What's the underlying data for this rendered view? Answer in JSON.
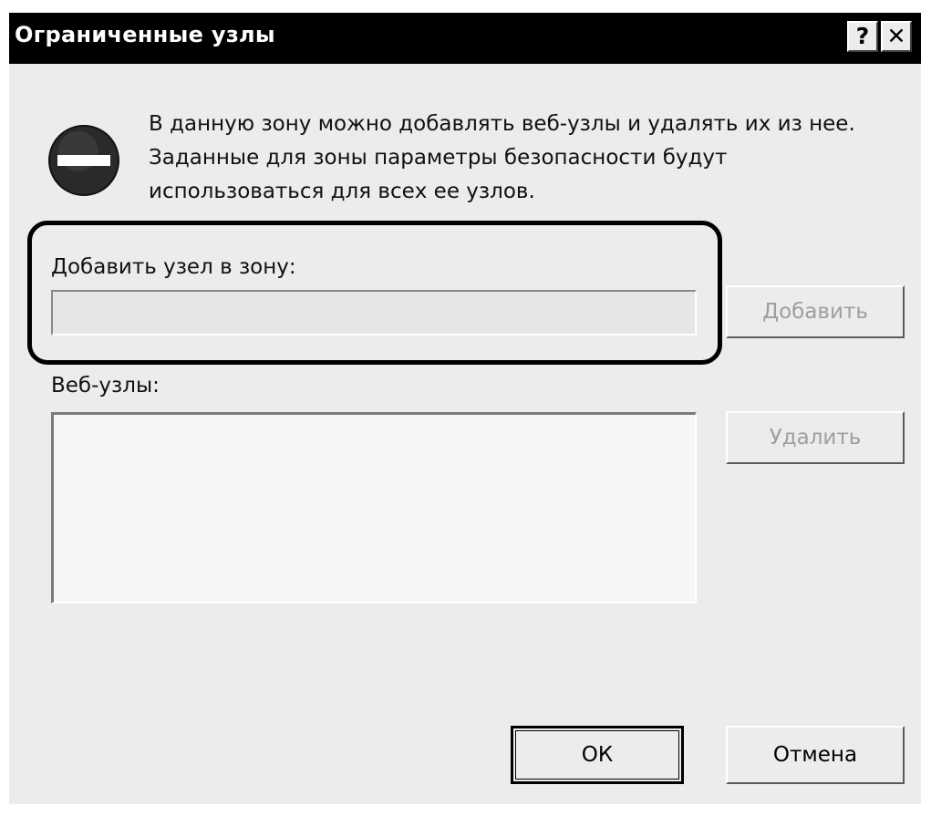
{
  "window": {
    "title": "Ограниченные узлы",
    "help_glyph": "?",
    "close_glyph": "✕"
  },
  "intro": {
    "icon": "restricted-zone-icon",
    "text": "В данную зону можно добавлять веб-узлы и удалять их из нее. Заданные для зоны параметры безопасности будут использоваться для всех ее узлов."
  },
  "add_site": {
    "label": "Добавить узел  в зону:",
    "value": "",
    "placeholder": "",
    "button_label": "Добавить",
    "button_enabled": false
  },
  "sites": {
    "label": "Веб-узлы:",
    "items": [],
    "remove_button_label": "Удалить",
    "remove_button_enabled": false
  },
  "footer": {
    "ok_label": "ОК",
    "cancel_label": "Отмена"
  }
}
